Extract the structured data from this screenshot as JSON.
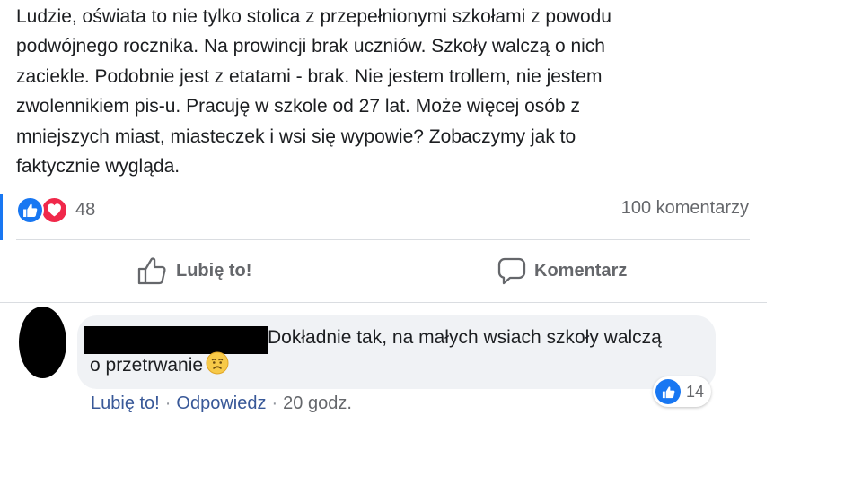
{
  "post": {
    "lines": [
      "Ludzie, oświata to nie tylko stolica z przepełnionymi szkołami z powodu",
      "podwójnego rocznika. Na prowincji brak uczniów. Szkoły walczą o nich",
      "zaciekle. Podobnie jest z etatami - brak. Nie jestem trollem, nie jestem",
      "zwolennikiem pis-u. Pracuję w szkole od 27 lat. Może więcej osób z",
      "mniejszych miast, miasteczek i wsi się wypowie? Zobaczymy jak to",
      "faktycznie wygląda."
    ]
  },
  "stats": {
    "reactions": [
      "like-icon",
      "love-icon"
    ],
    "reaction_count": "48",
    "comments_count": "100 komentarzy"
  },
  "actions": {
    "like_label": "Lubię to!",
    "comment_label": "Komentarz"
  },
  "comment": {
    "text_line1": "Dokładnie tak, na małych wsiach szkoły walczą",
    "text_line2": "o przetrwanie",
    "emoji": "sad-face-emoji",
    "reaction_icon": "like-icon",
    "reaction_count": "14",
    "like_link": "Lubię to!",
    "reply_link": "Odpowiedz",
    "separator": "·",
    "time": "20 godz."
  },
  "colors": {
    "accent": "#1877f2",
    "love": "#f0284a",
    "link": "#385898",
    "muted": "#65676b",
    "bubble": "#f0f2f5"
  }
}
